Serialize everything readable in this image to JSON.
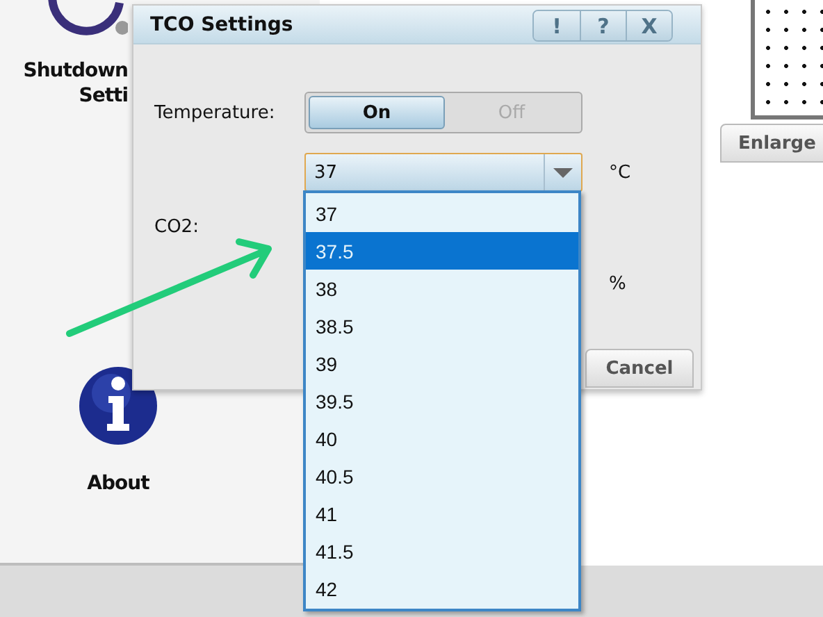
{
  "tools": [
    {
      "kind": "shutdown",
      "lines": [
        "Shutdown",
        "Setti"
      ]
    },
    {
      "kind": "about",
      "lines": [
        "About"
      ]
    }
  ],
  "enlarge_button": {
    "label": "Enlarge"
  },
  "dialog": {
    "title": "TCO Settings",
    "title_buttons": [
      "!",
      "?",
      "X"
    ],
    "temperature": {
      "label": "Temperature:",
      "options": [
        {
          "label": "On",
          "selected": true
        },
        {
          "label": "Off",
          "selected": false
        }
      ]
    },
    "setpoint": {
      "value": "37",
      "unit": "°C",
      "expanded": true
    },
    "co2": {
      "label": "CO2:",
      "unit": "%"
    },
    "cancel_button": {
      "label": "Cancel"
    }
  },
  "dropdown": {
    "items": [
      {
        "label": "37",
        "selected": false
      },
      {
        "label": "37.5",
        "selected": true
      },
      {
        "label": "38",
        "selected": false
      },
      {
        "label": "38.5",
        "selected": false
      },
      {
        "label": "39",
        "selected": false
      },
      {
        "label": "39.5",
        "selected": false
      },
      {
        "label": "40",
        "selected": false
      },
      {
        "label": "40.5",
        "selected": false
      },
      {
        "label": "41",
        "selected": false
      },
      {
        "label": "41.5",
        "selected": false
      },
      {
        "label": "42",
        "selected": false
      }
    ]
  }
}
